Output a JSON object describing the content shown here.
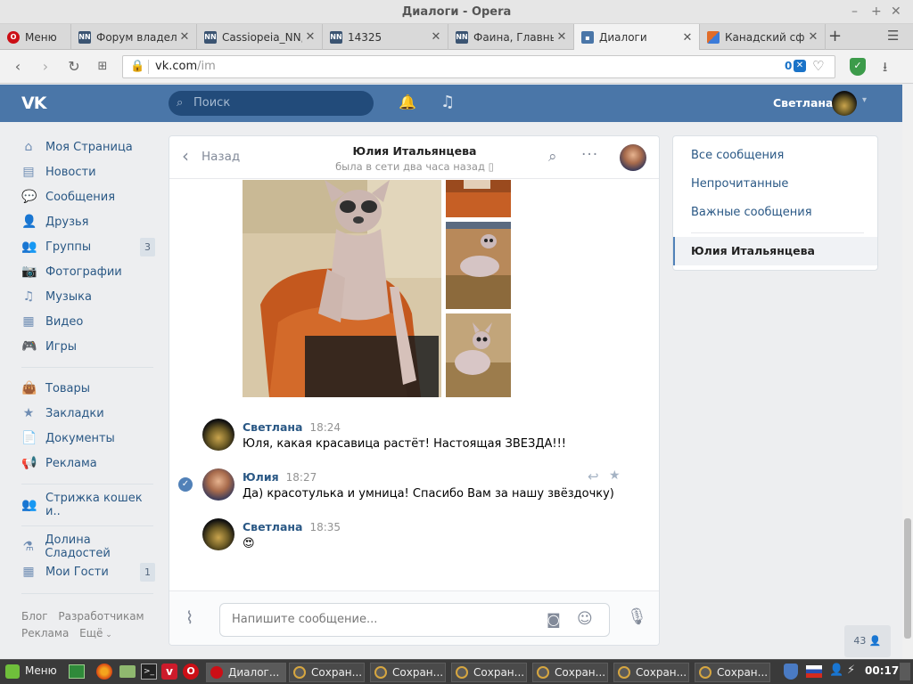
{
  "window": {
    "title": "Диалоги - Opera"
  },
  "tabs": [
    {
      "label": "Меню",
      "icon": "opera-icon",
      "color": "#cc0f16"
    },
    {
      "label": "Форум владел",
      "icon": "nn-icon",
      "color": "#3b5472"
    },
    {
      "label": "Cassiopeia_NN,",
      "icon": "nn-icon",
      "color": "#3b5472"
    },
    {
      "label": "14325",
      "icon": "nn-icon",
      "color": "#3b5472"
    },
    {
      "label": "Фаина, Главны",
      "icon": "nn-icon",
      "color": "#3b5472"
    },
    {
      "label": "Диалоги",
      "icon": "vk-message-icon",
      "color": "#4a76a8"
    },
    {
      "label": "Канадский сф",
      "icon": "puzzle-icon",
      "color": "#e06c2a"
    }
  ],
  "address": {
    "domain": "vk.com",
    "path": "/im",
    "badge": "0"
  },
  "vk_header": {
    "search_placeholder": "Поиск",
    "user_name": "Светлана"
  },
  "sidebar": {
    "items": [
      {
        "label": "Моя Страница",
        "icon": "home-icon",
        "glyph": "⌂"
      },
      {
        "label": "Новости",
        "icon": "news-icon",
        "glyph": "▤"
      },
      {
        "label": "Сообщения",
        "icon": "chat-icon",
        "glyph": "💬"
      },
      {
        "label": "Друзья",
        "icon": "user-icon",
        "glyph": "👤"
      },
      {
        "label": "Группы",
        "icon": "groups-icon",
        "glyph": "👥",
        "count": "3"
      },
      {
        "label": "Фотографии",
        "icon": "camera-icon",
        "glyph": "📷"
      },
      {
        "label": "Музыка",
        "icon": "music-icon",
        "glyph": "♫"
      },
      {
        "label": "Видео",
        "icon": "film-icon",
        "glyph": "▦"
      },
      {
        "label": "Игры",
        "icon": "gamepad-icon",
        "glyph": "🎮"
      }
    ],
    "items2": [
      {
        "label": "Товары",
        "icon": "bag-icon",
        "glyph": "👜"
      },
      {
        "label": "Закладки",
        "icon": "star-icon",
        "glyph": "★"
      },
      {
        "label": "Документы",
        "icon": "document-icon",
        "glyph": "📄"
      },
      {
        "label": "Реклама",
        "icon": "megaphone-icon",
        "glyph": "📢"
      }
    ],
    "items3": [
      {
        "label": "Стрижка кошек и..",
        "icon": "groups-icon",
        "glyph": "👥"
      }
    ],
    "items4": [
      {
        "label": "Долина Сладостей",
        "icon": "flask-icon",
        "glyph": "⚗"
      },
      {
        "label": "Мои Гости",
        "icon": "apps-icon",
        "glyph": "▦",
        "count": "1"
      }
    ],
    "footer": {
      "blog": "Блог",
      "dev": "Разработчикам",
      "ads": "Реклама",
      "more": "Ещё"
    }
  },
  "dialog": {
    "back": "Назад",
    "peer_name": "Юлия Итальянцева",
    "peer_status": "была в сети два часа назад",
    "messages": [
      {
        "author": "Светлана",
        "time": "18:24",
        "text": "Юля, какая красавица растёт! Настоящая ЗВЕЗДА!!!"
      },
      {
        "author": "Юлия",
        "time": "18:27",
        "text": "Да) красотулька и умница! Спасибо Вам за нашу звёздочку)"
      },
      {
        "author": "Светлана",
        "time": "18:35",
        "text": "😍"
      }
    ],
    "input_placeholder": "Напишите сообщение..."
  },
  "right_nav": {
    "items": [
      "Все сообщения",
      "Непрочитанные",
      "Важные сообщения"
    ],
    "active": "Юлия Итальянцева"
  },
  "online_count": "43",
  "taskbar": {
    "menu": "Меню",
    "windows": [
      {
        "label": "Диалог..."
      },
      {
        "label": "Сохран..."
      },
      {
        "label": "Сохран..."
      },
      {
        "label": "Сохран..."
      },
      {
        "label": "Сохран..."
      },
      {
        "label": "Сохран..."
      },
      {
        "label": "Сохран..."
      }
    ],
    "clock": "00:17"
  },
  "colors": {
    "vk_blue": "#4a76a8",
    "link": "#2a5885",
    "opera_red": "#cc0f16"
  }
}
